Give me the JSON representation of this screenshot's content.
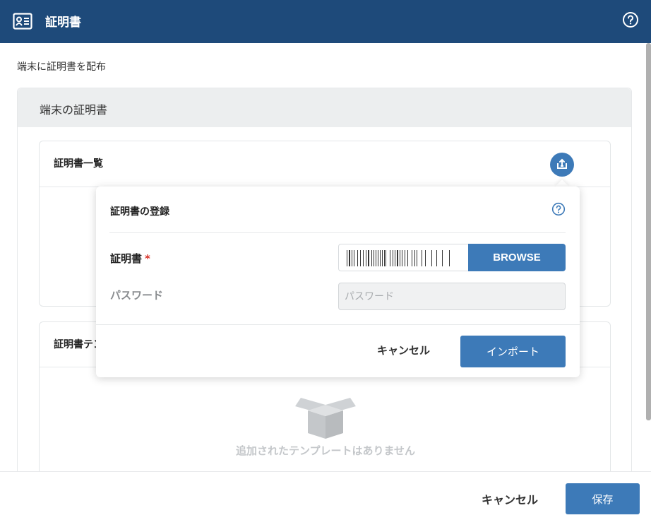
{
  "header": {
    "title": "証明書",
    "app_icon": "certificate-id-icon",
    "help_icon": "help-circle-icon"
  },
  "page": {
    "subtitle": "端末に証明書を配布"
  },
  "card": {
    "title": "端末の証明書"
  },
  "cert_list": {
    "title": "証明書一覧",
    "import_icon": "import-tray-icon"
  },
  "template_panel": {
    "title": "証明書テンプレート",
    "empty_text": "追加されたテンプレートはありません",
    "empty_icon": "empty-box-icon"
  },
  "popup": {
    "title": "証明書の登録",
    "help_icon": "help-circle-icon",
    "cert_label": "証明書",
    "required_mark": "*",
    "browse_label": "BROWSE",
    "password_label": "パスワード",
    "password_placeholder": "パスワード",
    "cancel_label": "キャンセル",
    "import_label": "インポート"
  },
  "footer": {
    "cancel_label": "キャンセル",
    "save_label": "保存"
  },
  "colors": {
    "header_bg": "#1e4a7a",
    "accent": "#3d7ab8",
    "required": "#d9342b"
  }
}
